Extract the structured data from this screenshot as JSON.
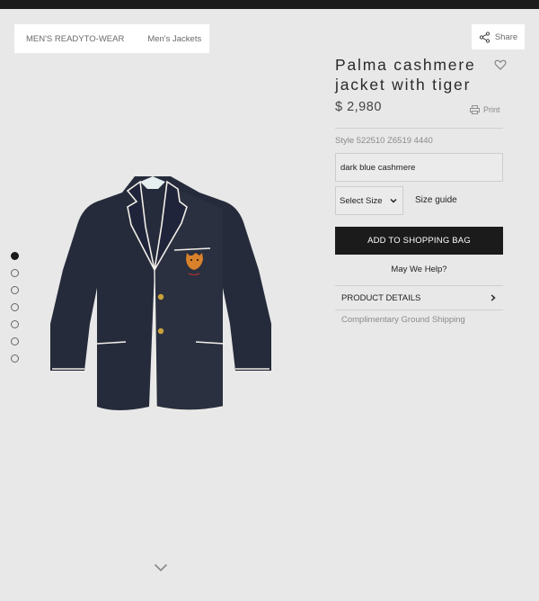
{
  "breadcrumb": {
    "items": [
      "MEN'S READYTO-WEAR",
      "Men's Jackets"
    ]
  },
  "share": {
    "label": "Share",
    "icon": "share-icon"
  },
  "product": {
    "title": "Palma cashmere jacket with tiger",
    "price": "$ 2,980",
    "style_code": "Style 522510 Z6519 4440",
    "color": "dark blue cashmere",
    "size_select_label": "Select Size",
    "size_guide": "Size guide",
    "add_to_bag": "ADD TO SHOPPING BAG",
    "help": "May We Help?",
    "details_label": "PRODUCT DETAILS",
    "shipping": "Complimentary Ground Shipping"
  },
  "print": {
    "label": "Print",
    "icon": "printer-icon"
  },
  "gallery": {
    "image_count": 7,
    "active_index": 0
  },
  "colors": {
    "top_bar": "#1c1c1c",
    "background": "#e8e8e8",
    "button": "#1b1b1b",
    "jacket": "#262b3b",
    "piping": "#f2efe8",
    "lining": "#bcd8d8",
    "crest": "#d9822b"
  }
}
